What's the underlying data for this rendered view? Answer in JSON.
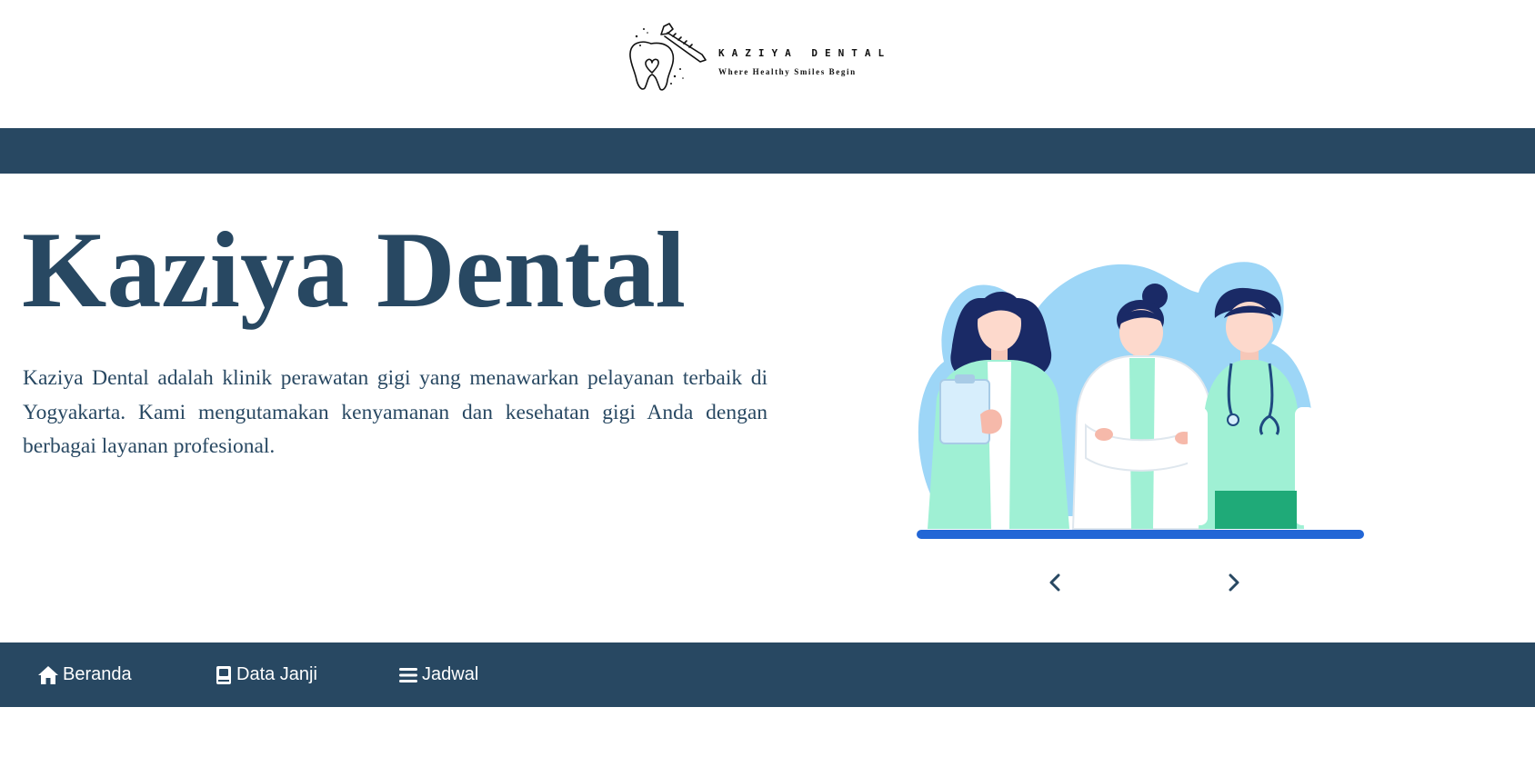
{
  "brand": {
    "logo_name": "KAZIYA DENTAL",
    "logo_tagline": "Where Healthy Smiles Begin"
  },
  "colors": {
    "primary": "#284862",
    "illustration_blob": "#9dd6f7",
    "scrub_green": "#9ff0d4",
    "base_line": "#2266d6"
  },
  "hero": {
    "title": "Kaziya Dental",
    "description": "Kaziya Dental adalah klinik perawatan gigi yang menawarkan pelayanan terbaik di Yogyakarta. Kami mengutamakan kenyamanan dan kesehatan gigi Anda dengan berbagai layanan profesional."
  },
  "carousel": {
    "prev_icon": "chevron-left-icon",
    "next_icon": "chevron-right-icon"
  },
  "nav": {
    "items": [
      {
        "label": "Beranda",
        "icon": "home-icon"
      },
      {
        "label": "Data Janji",
        "icon": "book-icon"
      },
      {
        "label": "Jadwal",
        "icon": "menu-icon"
      }
    ]
  }
}
